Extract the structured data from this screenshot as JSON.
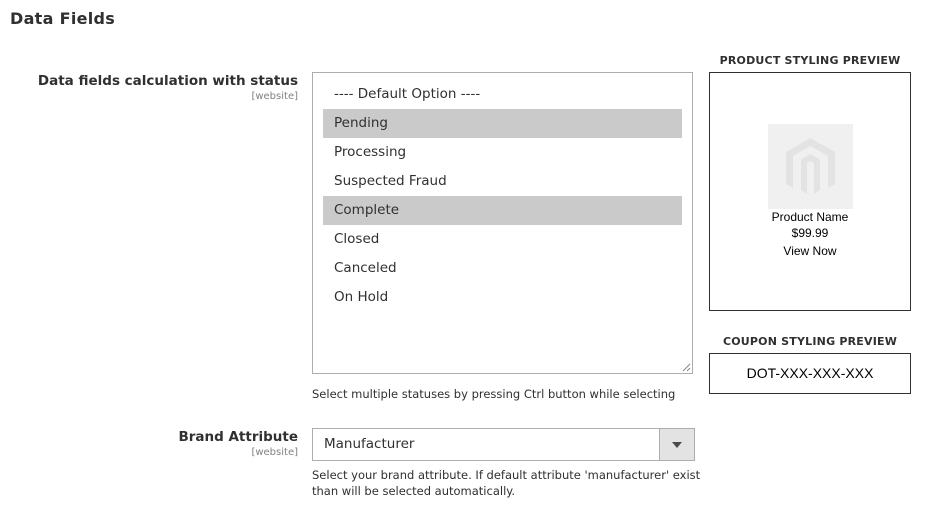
{
  "section": {
    "title": "Data Fields"
  },
  "status_field": {
    "label": "Data fields calculation with status",
    "scope": "[website]",
    "options": [
      {
        "label": "---- Default Option ----",
        "selected": false
      },
      {
        "label": "Pending",
        "selected": true
      },
      {
        "label": "Processing",
        "selected": false
      },
      {
        "label": "Suspected Fraud",
        "selected": false
      },
      {
        "label": "Complete",
        "selected": true
      },
      {
        "label": "Closed",
        "selected": false
      },
      {
        "label": "Canceled",
        "selected": false
      },
      {
        "label": "On Hold",
        "selected": false
      }
    ],
    "note": "Select multiple statuses by pressing Ctrl button while selecting"
  },
  "brand_field": {
    "label": "Brand Attribute",
    "scope": "[website]",
    "value": "Manufacturer",
    "note_line1": "Select your brand attribute. If default attribute 'manufacturer' exist",
    "note_line2": "than will be selected automatically."
  },
  "product_preview": {
    "title": "PRODUCT STYLING PREVIEW",
    "product_name": "Product Name",
    "price": "$99.99",
    "link": "View Now",
    "image_icon": "magento-logo-icon"
  },
  "coupon_preview": {
    "title": "COUPON STYLING PREVIEW",
    "code": "DOT-XXX-XXX-XXX"
  },
  "colors": {
    "selected_option_bg": "#cacaca",
    "border": "#adadad",
    "text": "#303030"
  }
}
